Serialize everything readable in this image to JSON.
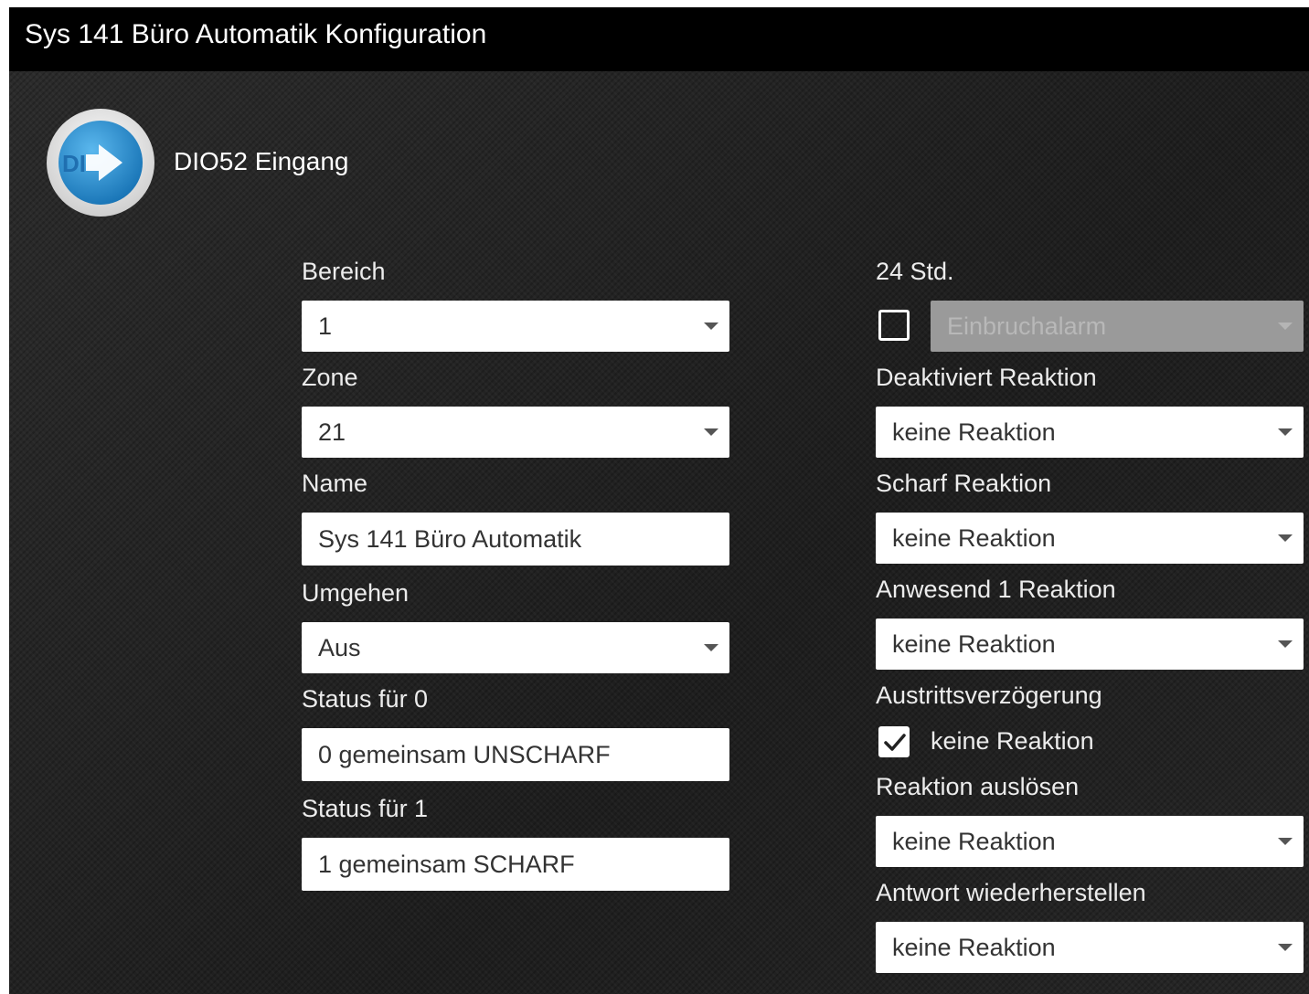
{
  "window": {
    "title": "Sys 141 Büro Automatik Konfiguration"
  },
  "device": {
    "icon_text": "DI",
    "name": "DIO52 Eingang"
  },
  "left": {
    "bereich": {
      "label": "Bereich",
      "value": "1"
    },
    "zone": {
      "label": "Zone",
      "value": "21"
    },
    "name": {
      "label": "Name",
      "value": "Sys 141 Büro Automatik"
    },
    "umgehen": {
      "label": "Umgehen",
      "value": "Aus"
    },
    "status0": {
      "label": "Status für 0",
      "value": "0 gemeinsam UNSCHARF"
    },
    "status1": {
      "label": "Status für 1",
      "value": "1 gemeinsam SCHARF"
    }
  },
  "right": {
    "std24": {
      "label": "24 Std.",
      "checked": false,
      "value": "Einbruchalarm",
      "disabled": true
    },
    "deaktiviert": {
      "label": "Deaktiviert Reaktion",
      "value": "keine Reaktion"
    },
    "scharf": {
      "label": "Scharf Reaktion",
      "value": "keine Reaktion"
    },
    "anwesend1": {
      "label": "Anwesend 1 Reaktion",
      "value": "keine Reaktion"
    },
    "austritt": {
      "label": "Austrittsverzögerung",
      "checked": true,
      "check_label": "keine Reaktion"
    },
    "ausloesen": {
      "label": "Reaktion auslösen",
      "value": "keine Reaktion"
    },
    "antwort": {
      "label": "Antwort wiederherstellen",
      "value": "keine Reaktion"
    }
  },
  "colors": {
    "title_bar": "#000000",
    "background": "#262626",
    "icon_blue": "#2a8fd0",
    "field_bg": "#ffffff",
    "disabled_field_bg": "#9a9a9a"
  }
}
